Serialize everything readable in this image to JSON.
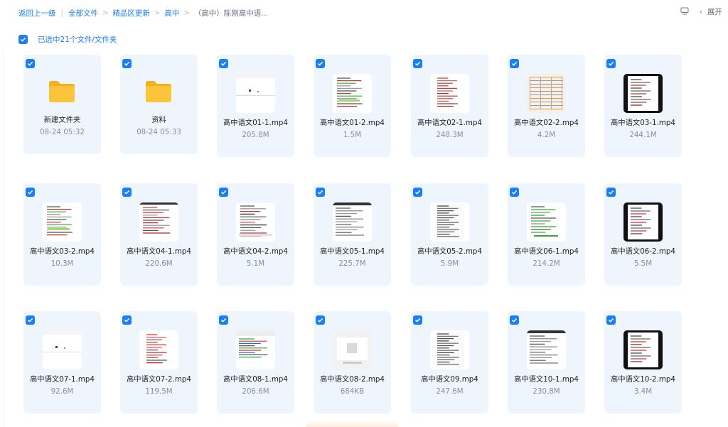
{
  "breadcrumb": {
    "back": "返回上一级",
    "items": [
      "全部文件",
      "精品区更新",
      "高中",
      "（高中）陈刚高中语..."
    ]
  },
  "topbar": {
    "expand_label": "展开",
    "screen_icon": "screen-icon",
    "chevron_icon": "chevron-left-icon"
  },
  "selection": {
    "label": "已选中21个文件/文件夹"
  },
  "colors": {
    "accent": "#1a7ff5",
    "card_bg": "#eef5fd",
    "folder": "#fcc43b"
  },
  "files": [
    {
      "type": "folder",
      "name": "新建文件夹",
      "meta": "08-24 05:32"
    },
    {
      "type": "folder",
      "name": "资料",
      "meta": "08-24 05:33"
    },
    {
      "type": "video",
      "name": "高中语文01-1.mp4",
      "meta": "205.8M",
      "thumb": "wide-white"
    },
    {
      "type": "video",
      "name": "高中语文01-2.mp4",
      "meta": "1.5M",
      "thumb": "doc-color"
    },
    {
      "type": "video",
      "name": "高中语文02-1.mp4",
      "meta": "248.3M",
      "thumb": "doc-red"
    },
    {
      "type": "video",
      "name": "高中语文02-2.mp4",
      "meta": "4.2M",
      "thumb": "table"
    },
    {
      "type": "video",
      "name": "高中语文03-1.mp4",
      "meta": "244.1M",
      "thumb": "dark-frame"
    },
    {
      "type": "video",
      "name": "高中语文03-2.mp4",
      "meta": "10.3M",
      "thumb": "doc-color"
    },
    {
      "type": "video",
      "name": "高中语文04-1.mp4",
      "meta": "220.6M",
      "thumb": "doc-red-wide"
    },
    {
      "type": "video",
      "name": "高中语文04-2.mp4",
      "meta": "5.1M",
      "thumb": "doc-mixed"
    },
    {
      "type": "video",
      "name": "高中语文05-1.mp4",
      "meta": "225.7M",
      "thumb": "doc-wide"
    },
    {
      "type": "video",
      "name": "高中语文05-2.mp4",
      "meta": "5.9M",
      "thumb": "dense-text"
    },
    {
      "type": "video",
      "name": "高中语文06-1.mp4",
      "meta": "214.2M",
      "thumb": "doc-green"
    },
    {
      "type": "video",
      "name": "高中语文06-2.mp4",
      "meta": "5.5M",
      "thumb": "dark-frame"
    },
    {
      "type": "video",
      "name": "高中语文07-1.mp4",
      "meta": "92.6M",
      "thumb": "wide-white"
    },
    {
      "type": "video",
      "name": "高中语文07-2.mp4",
      "meta": "119.5M",
      "thumb": "doc-red"
    },
    {
      "type": "video",
      "name": "高中语文08-1.mp4",
      "meta": "206.6M",
      "thumb": "doc-color-wide"
    },
    {
      "type": "video",
      "name": "高中语文08-2.mp4",
      "meta": "684KB",
      "thumb": "gray-ui"
    },
    {
      "type": "video",
      "name": "高中语文09.mp4",
      "meta": "247.6M",
      "thumb": "dense-text"
    },
    {
      "type": "video",
      "name": "高中语文10-1.mp4",
      "meta": "230.8M",
      "thumb": "doc-wide"
    },
    {
      "type": "video",
      "name": "高中语文10-2.mp4",
      "meta": "3.4M",
      "thumb": "dark-frame"
    }
  ]
}
